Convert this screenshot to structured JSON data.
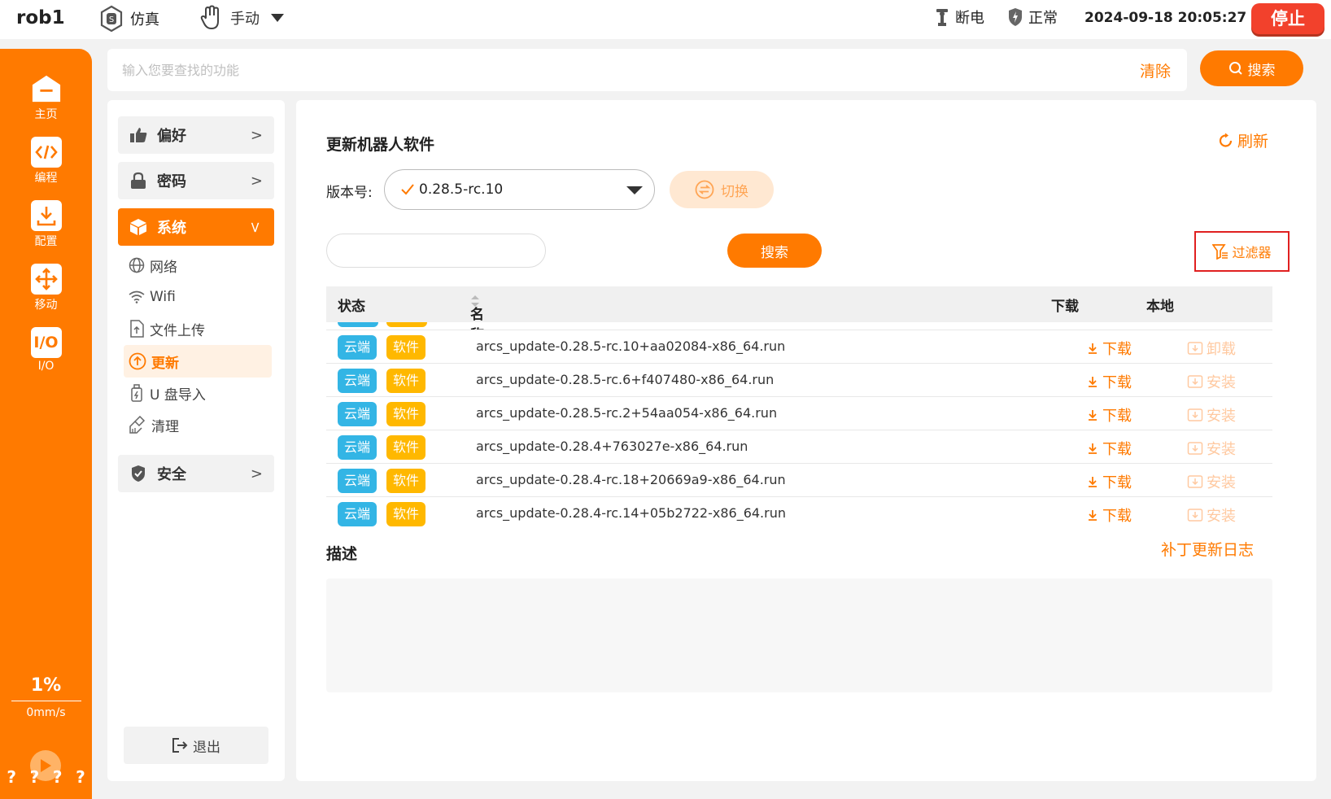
{
  "topbar": {
    "robot_name": "rob1",
    "sim_label": "仿真",
    "manual_label": "手动",
    "power_label": "断电",
    "safety_label": "正常",
    "datetime": "2024-09-18 20:05:27",
    "stop_label": "停止"
  },
  "sidebar": {
    "items": [
      {
        "label": "主页",
        "icon": "home-icon"
      },
      {
        "label": "编程",
        "icon": "code-icon"
      },
      {
        "label": "配置",
        "icon": "download-icon"
      },
      {
        "label": "移动",
        "icon": "move-icon"
      },
      {
        "label": "I/O",
        "icon": "io-icon"
      }
    ],
    "speed_percent": "1%",
    "speed_value": "0mm/s",
    "bottom_marks": [
      "?",
      "?",
      "?",
      "?"
    ]
  },
  "search": {
    "placeholder": "输入您要查找的功能",
    "clear_label": "清除",
    "button_label": "搜索"
  },
  "settings_menu": {
    "groups": [
      {
        "label": "偏好",
        "icon": "thumbs-up-icon"
      },
      {
        "label": "密码",
        "icon": "lock-icon"
      },
      {
        "label": "系统",
        "icon": "cube-icon"
      },
      {
        "label": "安全",
        "icon": "shield-icon"
      }
    ],
    "system_items": [
      {
        "label": "网络",
        "icon": "globe-icon"
      },
      {
        "label": "Wifi",
        "icon": "wifi-icon"
      },
      {
        "label": "文件上传",
        "icon": "file-upload-icon"
      },
      {
        "label": "更新",
        "icon": "update-icon"
      },
      {
        "label": "U 盘导入",
        "icon": "usb-icon"
      },
      {
        "label": "清理",
        "icon": "broom-icon"
      }
    ],
    "logout_label": "退出"
  },
  "update_page": {
    "title": "更新机器人软件",
    "refresh_label": "刷新",
    "version_label": "版本号:",
    "version_value": "0.28.5-rc.10",
    "switch_label": "切换",
    "table_search_value": "",
    "table_search_button": "搜索",
    "filter_label": "过滤器",
    "columns": [
      "状态",
      "名称",
      "下载",
      "本地"
    ],
    "rows": [
      {
        "status_tags": [
          "云端",
          "软件"
        ],
        "name": "arcs_update-0.28.5-rc.10+aa02084-x86_64.run",
        "download": "下载",
        "local_action": "卸载"
      },
      {
        "status_tags": [
          "云端",
          "软件"
        ],
        "name": "arcs_update-0.28.5-rc.6+f407480-x86_64.run",
        "download": "下载",
        "local_action": "安装"
      },
      {
        "status_tags": [
          "云端",
          "软件"
        ],
        "name": "arcs_update-0.28.5-rc.2+54aa054-x86_64.run",
        "download": "下载",
        "local_action": "安装"
      },
      {
        "status_tags": [
          "云端",
          "软件"
        ],
        "name": "arcs_update-0.28.4+763027e-x86_64.run",
        "download": "下载",
        "local_action": "安装"
      },
      {
        "status_tags": [
          "云端",
          "软件"
        ],
        "name": "arcs_update-0.28.4-rc.18+20669a9-x86_64.run",
        "download": "下载",
        "local_action": "安装"
      },
      {
        "status_tags": [
          "云端",
          "软件"
        ],
        "name": "arcs_update-0.28.4-rc.14+05b2722-x86_64.run",
        "download": "下载",
        "local_action": "安装"
      }
    ],
    "description_title": "描述",
    "patch_log_label": "补丁更新日志",
    "description_text": ""
  },
  "colors": {
    "accent": "#ff7a00",
    "stop": "#f2412c",
    "cloud_tag": "#33b5e5",
    "software_tag": "#ffb800",
    "filter_highlight": "#e02020"
  }
}
